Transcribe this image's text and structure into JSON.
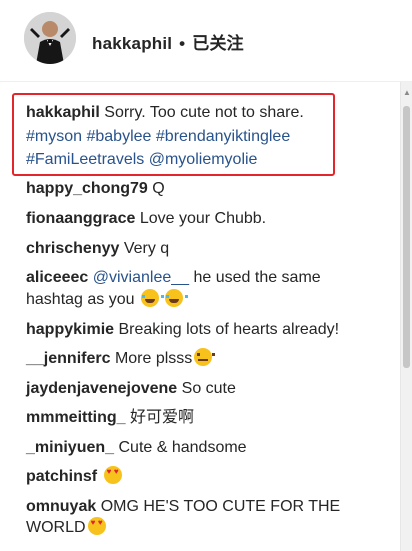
{
  "header": {
    "username": "hakkaphil",
    "separator": "•",
    "follow_status": "已关注"
  },
  "caption": {
    "user": "hakkaphil",
    "text": "Sorry. Too cute not to share.",
    "tags_line1": [
      "#myson",
      "#babylee",
      "#brendanyiktinglee"
    ],
    "tags_line2": [
      "#FamiLeetravels",
      "@myoliemyolie"
    ]
  },
  "comments": [
    {
      "user": "happy_chong79",
      "text": "Q"
    },
    {
      "user": "fionaanggrace",
      "text": "Love your Chubb."
    },
    {
      "user": "chrischenyy",
      "text": "Very q"
    },
    {
      "user": "aliceeec",
      "mention": "@vivianlee__",
      "text": "he used the same",
      "text2": "hashtag as you",
      "emoji": [
        "joy",
        "joy"
      ]
    },
    {
      "user": "happykimie",
      "text": "Breaking lots of hearts already!"
    },
    {
      "user": "__jenniferc",
      "text": "More plsss",
      "emoji": [
        "sweat"
      ]
    },
    {
      "user": "jaydenjavenejovene",
      "text": "So cute"
    },
    {
      "user": "mmmeitting_",
      "text": "好可爱啊"
    },
    {
      "user": "_miniyuen_",
      "text": "Cute & handsome"
    },
    {
      "user": "patchinsf",
      "text": "",
      "emoji": [
        "heart-eyes"
      ]
    },
    {
      "user": "omnuyak",
      "text": "OMG HE'S TOO CUTE FOR THE",
      "text2": "WORLD",
      "emoji": [
        "heart-eyes"
      ]
    }
  ],
  "icons": {
    "scroll_up": "scroll-up-arrow-icon",
    "emoji_joy": "tears-of-joy-emoji-icon",
    "emoji_sweat": "sweat-smile-emoji-icon",
    "emoji_heart_eyes": "heart-eyes-emoji-icon"
  },
  "colors": {
    "hashtag": "#29538c",
    "highlight_border": "#e3262b"
  }
}
